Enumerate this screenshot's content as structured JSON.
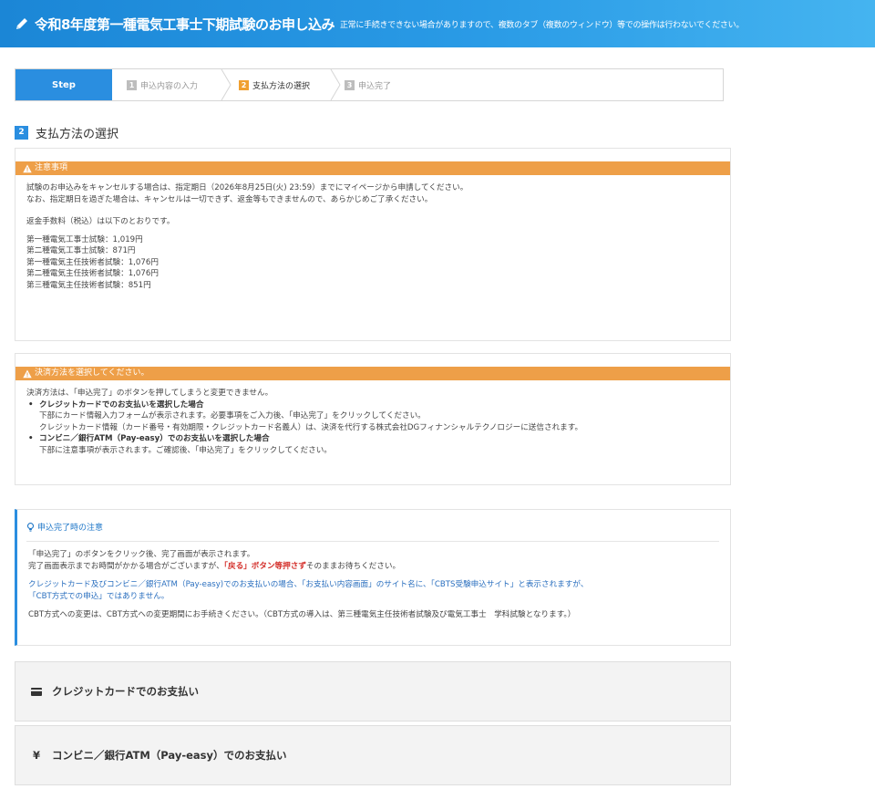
{
  "header": {
    "title": "令和8年度第一種電気工事士下期試験のお申し込み",
    "note": "正常に手続きできない場合がありますので、複数のタブ（複数のウィンドウ）等での操作は行わないでください。"
  },
  "steps": {
    "head": "Step",
    "items": [
      {
        "num": "1",
        "label": "申込内容の入力"
      },
      {
        "num": "2",
        "label": "支払方法の選択"
      },
      {
        "num": "3",
        "label": "申込完了"
      }
    ]
  },
  "section": {
    "num": "2",
    "title": "支払方法の選択"
  },
  "caution": {
    "title": "注意事項",
    "lines": [
      "試験のお申込みをキャンセルする場合は、指定期日（2026年8月25日(火) 23:59）までにマイページから申請してください。",
      "なお、指定期日を過ぎた場合は、キャンセルは一切できず、返金等もできませんので、あらかじめご了承ください。"
    ],
    "fee_heading": "返金手数料（税込）は以下のとおりです。",
    "fees": [
      "第一種電気工事士試験：1,019円",
      "第二種電気工事士試験：871円",
      "第一種電気主任技術者試験：1,076円",
      "第二種電気主任技術者試験：1,076円",
      "第三種電気主任技術者試験：851円"
    ]
  },
  "method": {
    "title": "決済方法を選択してください。",
    "intro": "決済方法は、「申込完了」のボタンを押してしまうと変更できません。",
    "bullets": [
      {
        "head": "クレジットカードでのお支払いを選択した場合",
        "sub": [
          "下部にカード情報入力フォームが表示されます。必要事項をご入力後、「申込完了」をクリックしてください。",
          "クレジットカード情報（カード番号・有効期限・クレジットカード名義人）は、決済を代行する株式会社DGフィナンシャルテクノロジーに送信されます。"
        ]
      },
      {
        "head": "コンビニ／銀行ATM（Pay-easy）でのお支払いを選択した場合",
        "sub": [
          "下部に注意事項が表示されます。ご確認後、「申込完了」をクリックしてください。"
        ]
      }
    ]
  },
  "notice": {
    "title": "申込完了時の注意",
    "line1": "「申込完了」のボタンをクリック後、完了画面が表示されます。",
    "line2_pre": "完了画面表示までお時間がかかる場合がございますが、",
    "line2_red": "「戻る」ボタン等押さず",
    "line2_post": "そのままお待ちください。",
    "blue1": "クレジットカード及びコンビニ／銀行ATM（Pay-easy)でのお支払いの場合、「お支払い内容画面」のサイト名に、「CBTS受験申込サイト」と表示されますが、",
    "blue2": "「CBT方式での申込」ではありません。",
    "cbt": "CBT方式への変更は、CBT方式への変更期間にお手続きください。（CBT方式の導入は、第三種電気主任技術者試験及び電気工事士　学科試験となります。）"
  },
  "payment": {
    "credit": "クレジットカードでのお支払い",
    "conv_symbol": "¥",
    "conv": "コンビニ／銀行ATM（Pay-easy）でのお支払い"
  },
  "colors": {
    "header_blue": "#1b86d6",
    "step_blue": "#2a8ee0",
    "warning_orange": "#ee9f48",
    "emphasis_red": "#d4302b",
    "link_blue": "#2a6fbf"
  }
}
